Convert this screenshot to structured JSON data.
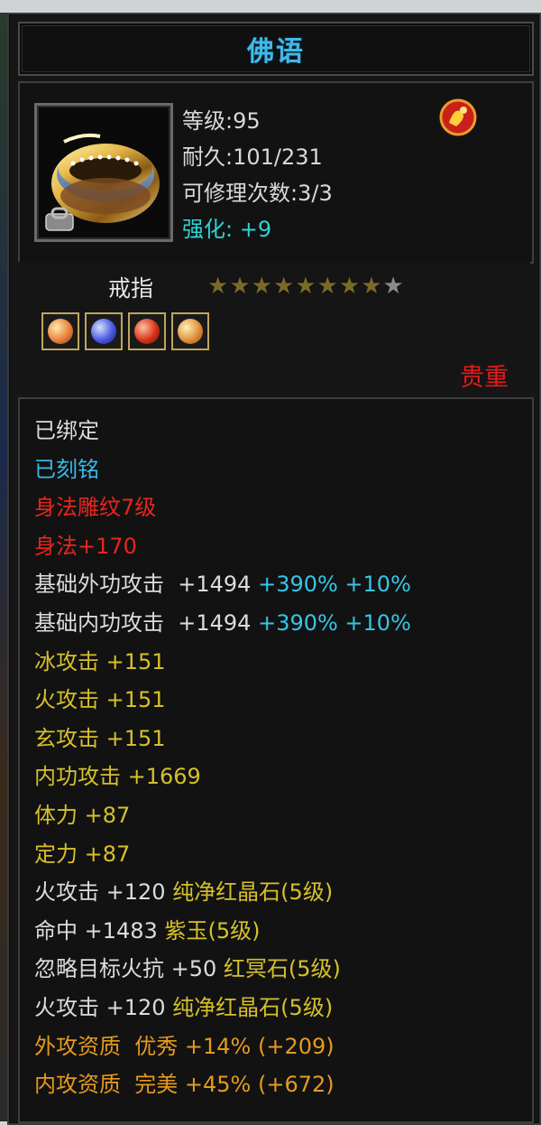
{
  "item": {
    "name": "佛语",
    "level": "等级:95",
    "durability": "耐久:101/231",
    "repairs": "可修理次数:3/3",
    "enhance": "强化: +9",
    "type": "戒指",
    "rarity": "贵重",
    "stars_filled": 8,
    "stars_total": 9
  },
  "icons": {
    "item_icon": "ring-icon",
    "bound_icon": "lock-icon",
    "class_badge": "character-badge-icon",
    "gems": [
      "orange-gem-icon",
      "blue-gem-icon",
      "red-gem-icon",
      "orange-gem-icon"
    ]
  },
  "colors": {
    "title": "#3fb9e9",
    "white": "#dcdcdc",
    "cyan": "#38b9e8",
    "red": "#e8251e",
    "yellow": "#d6c02a",
    "orange": "#e69a1e"
  },
  "attributes": {
    "bound": "已绑定",
    "engraved": "已刻铭",
    "carving": "身法雕纹7级",
    "agility": "身法+170",
    "ext_attack_label": "基础外功攻击  +1494 ",
    "ext_attack_pct": "+390% +10%",
    "int_attack_label": "基础内功攻击  +1494 ",
    "int_attack_pct": "+390% +10%",
    "ice": "冰攻击 +151",
    "fire": "火攻击 +151",
    "mystic": "玄攻击 +151",
    "inner": "内功攻击 +1669",
    "stamina": "体力 +87",
    "focus": "定力 +87",
    "gem1_stat": "火攻击 +120 ",
    "gem1_name": "纯净红晶石(5级)",
    "gem2_stat": "命中 +1483 ",
    "gem2_name": "紫玉(5级)",
    "gem3_stat": "忽略目标火抗 +50 ",
    "gem3_name": "红冥石(5级)",
    "gem4_stat": "火攻击 +120 ",
    "gem4_name": "纯净红晶石(5级)",
    "ext_quality": "外攻资质  优秀 +14% (+209)",
    "int_quality": "内攻资质  完美 +45% (+672)"
  }
}
